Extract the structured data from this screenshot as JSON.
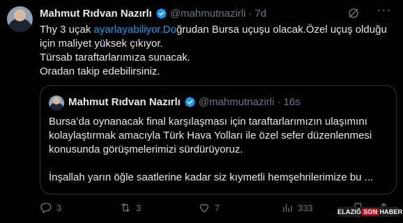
{
  "author": {
    "name": "Mahmut Rıdvan Nazırlı",
    "handle": "@mahmutnazirli",
    "separator": "·",
    "time": "7d"
  },
  "tweet": {
    "lines": [
      {
        "before": "Thy 3 uçak ",
        "link": "ayarlayabiliyor.Do",
        "after": "ğrudan Bursa uçuşu olacak.Özel uçuş olduğu için maliyet yüksek çıkıyor."
      },
      {
        "text": "Türsab taraftarlarımıza sunacak."
      },
      {
        "text": "Oradan takip edebilirsiniz."
      }
    ]
  },
  "quoted": {
    "name": "Mahmut Rıdvan Nazırlı",
    "handle": "@mahmutnazirli",
    "separator": "·",
    "time": "16s",
    "paragraph1": "Bursa’da oynanacak final karşılaşması için taraftarlarımızın ulaşımını kolaylaştırmak amacıyla Türk Hava Yolları ile özel sefer düzenlenmesi konusunda görüşmelerimizi sürdürüyoruz.",
    "paragraph2": "İnşallah yarın öğle saatlerine kadar siz kıymetli hemşehrilerimize bu ..."
  },
  "actions": {
    "replies": "3",
    "reposts": "3",
    "likes": "7",
    "views": "333"
  },
  "watermark": {
    "part1": "ELAZIĞ",
    "part2": "SON",
    "part3": "HABER"
  },
  "colors": {
    "background": "#000000",
    "text": "#e7e9ea",
    "muted": "#71767b",
    "link": "#1d9bf0",
    "border": "#2f3336",
    "verified": "#1d9bf0"
  },
  "icons": [
    "verified-badge-icon",
    "grok-icon",
    "more-icon",
    "reply-icon",
    "repost-icon",
    "like-icon",
    "views-icon",
    "bookmark-icon",
    "share-icon"
  ]
}
